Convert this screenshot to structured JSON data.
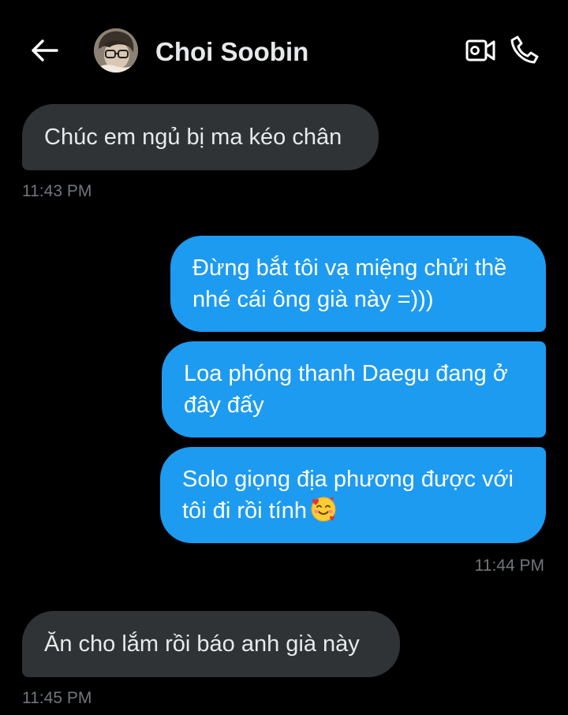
{
  "header": {
    "back_icon": "arrow-left-icon",
    "contact_name": "Choi Soobin",
    "video_icon": "video-camera-icon",
    "call_icon": "phone-icon"
  },
  "messages": [
    {
      "direction": "incoming",
      "lines": [
        "Chúc em ngủ bị ma kéo chân"
      ],
      "time": "11:43 PM"
    },
    {
      "direction": "outgoing",
      "lines": [
        "Đừng bắt tôi vạ miệng chửi thề",
        "nhé cái ông già này =)))"
      ]
    },
    {
      "direction": "outgoing",
      "lines": [
        "Loa phóng thanh Daegu đang ở",
        "đây đấy"
      ]
    },
    {
      "direction": "outgoing",
      "lines": [
        "Solo giọng địa phương được với",
        "tôi đi rồi tính"
      ],
      "emoji": "smiling-face-with-hearts-emoji",
      "time": "11:44 PM"
    },
    {
      "direction": "incoming",
      "lines": [
        "Ăn cho lắm rồi báo anh già này"
      ],
      "time": "11:45 PM"
    }
  ],
  "colors": {
    "background": "#000000",
    "incoming_bubble": "#2f3336",
    "outgoing_bubble": "#1d9bf0",
    "timestamp": "#71767b",
    "text": "#e7e9ea"
  }
}
